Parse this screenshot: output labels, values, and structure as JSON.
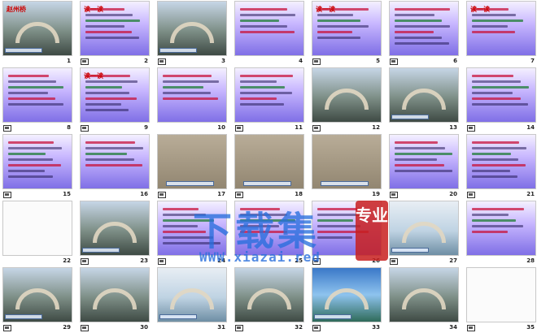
{
  "slides": [
    {
      "num": "1",
      "style": "photo",
      "title": "赵州桥"
    },
    {
      "num": "2",
      "style": "purple-text",
      "title": "读一读"
    },
    {
      "num": "3",
      "style": "photo"
    },
    {
      "num": "4",
      "style": "purple-text",
      "title": ""
    },
    {
      "num": "5",
      "style": "purple-text",
      "title": "读一读"
    },
    {
      "num": "6",
      "style": "purple-text",
      "title": ""
    },
    {
      "num": "7",
      "style": "purple-text",
      "title": "读一读"
    },
    {
      "num": "8",
      "style": "purple-text",
      "title": ""
    },
    {
      "num": "9",
      "style": "purple-text",
      "title": "读一读"
    },
    {
      "num": "10",
      "style": "purple-text",
      "title": ""
    },
    {
      "num": "11",
      "style": "purple-text",
      "title": ""
    },
    {
      "num": "12",
      "style": "photo"
    },
    {
      "num": "13",
      "style": "photo"
    },
    {
      "num": "14",
      "style": "purple-text",
      "title": ""
    },
    {
      "num": "15",
      "style": "purple-text",
      "title": ""
    },
    {
      "num": "16",
      "style": "purple-text",
      "title": ""
    },
    {
      "num": "17",
      "style": "stone"
    },
    {
      "num": "18",
      "style": "stone"
    },
    {
      "num": "19",
      "style": "stone"
    },
    {
      "num": "20",
      "style": "purple-text",
      "title": ""
    },
    {
      "num": "21",
      "style": "purple-text",
      "title": ""
    },
    {
      "num": "22",
      "style": "white"
    },
    {
      "num": "23",
      "style": "photo"
    },
    {
      "num": "24",
      "style": "purple-text",
      "title": ""
    },
    {
      "num": "25",
      "style": "purple-text",
      "title": ""
    },
    {
      "num": "26",
      "style": "purple-text",
      "title": ""
    },
    {
      "num": "27",
      "style": "lake"
    },
    {
      "num": "28",
      "style": "purple-text",
      "title": ""
    },
    {
      "num": "29",
      "style": "photo"
    },
    {
      "num": "30",
      "style": "photo"
    },
    {
      "num": "31",
      "style": "lake"
    },
    {
      "num": "32",
      "style": "photo"
    },
    {
      "num": "33",
      "style": "sky"
    },
    {
      "num": "34",
      "style": "photo"
    },
    {
      "num": "35",
      "style": "white"
    }
  ],
  "watermark": {
    "main": "下载集",
    "seal": "专业",
    "url": "WWW.xiazai.red"
  },
  "colors": {
    "accent": "#2a6ed8",
    "seal": "#c81e1e"
  }
}
